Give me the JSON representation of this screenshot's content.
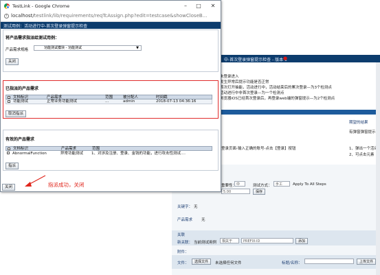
{
  "browser": {
    "window_title": "TestLink - Google Chrome",
    "url_host": "localhost/",
    "url_path": "testlink/lib/requirements/reqTcAssign.php?edit=testcase&showCloseB..."
  },
  "page": {
    "title": "测试用例：活动进行中-首次登录弹窗提示检查"
  },
  "assign_section": {
    "heading": "将产品需求指派给测试用例：",
    "spec_label": "产品需求规格",
    "spec_value": "功能测试模块 - 功能测试",
    "close_label": "关闭"
  },
  "assigned_section": {
    "heading": "已指派的产品需求",
    "columns": [
      "文档标识",
      "产品需求",
      "范围",
      "被分配人",
      "时间戳"
    ],
    "rows": [
      {
        "doc_id": "功能测试",
        "requirement": "正常业务功能测试",
        "scope": "...",
        "assignee": "admin",
        "timestamp": "2018-07-13 04:36:16"
      }
    ],
    "remove_label": "取消指派"
  },
  "available_section": {
    "heading": "有效的产品需求",
    "columns": [
      "文档标识",
      "产品需求",
      "范围"
    ],
    "rows": [
      {
        "doc_id": "AbnormalFunction",
        "requirement": "异常功能测试",
        "scope": "1、对涉及注册、登录、金钱的功能，进行攻击性测试...."
      }
    ],
    "assign_label": "指派"
  },
  "bottom_close_label": "关闭",
  "annotation": {
    "text": "指派成功，关闭",
    "color": "#e0261c"
  },
  "background_page": {
    "header_text": "中-首次登录弹窗提示检查 - 版本 1",
    "bullets": [
      "未登录进入",
      "发生异常后提示功能是否正常",
      "首次打开抽能，活动进行中，活动结束后的累次登录—为3个检测点",
      "活动进行中非首次登录—为一个检测点",
      "浏览器iOS已经首次登录后，再登录web端的弹窗提示—为2个检测点"
    ],
    "col_header": "期望的结果",
    "expected": "有弹窗弹窗提示，",
    "step_text": "登录页面-输入正确的账号-点击【登录】按钮",
    "expected_items": [
      "1、弹出一个活动",
      "2、可点击元素"
    ],
    "priority_label": "重要性：",
    "priority_value": "中",
    "exec_label": "测试方式：",
    "exec_value": "手工",
    "apply_label": "Apply To All Steps",
    "estimate_value": "5.00",
    "save_label": "保存",
    "keywords_label": "关键字：",
    "keywords_value": "无",
    "req_label": "产品需求",
    "req_value": "无",
    "relations_label": "关联",
    "new_relation_label": "新关联：",
    "new_relation_prefix": "当前测试用例",
    "relation_type": "相关于",
    "prefix_placeholder": "PREFIX-ID",
    "add_label": "添加",
    "attachments_label": "附件：",
    "file_label": "文件：",
    "choose_file_label": "选择文件",
    "no_file_label": "未选择任何文件",
    "title_name_label": "标题/名称：",
    "upload_label": "上传文件"
  }
}
